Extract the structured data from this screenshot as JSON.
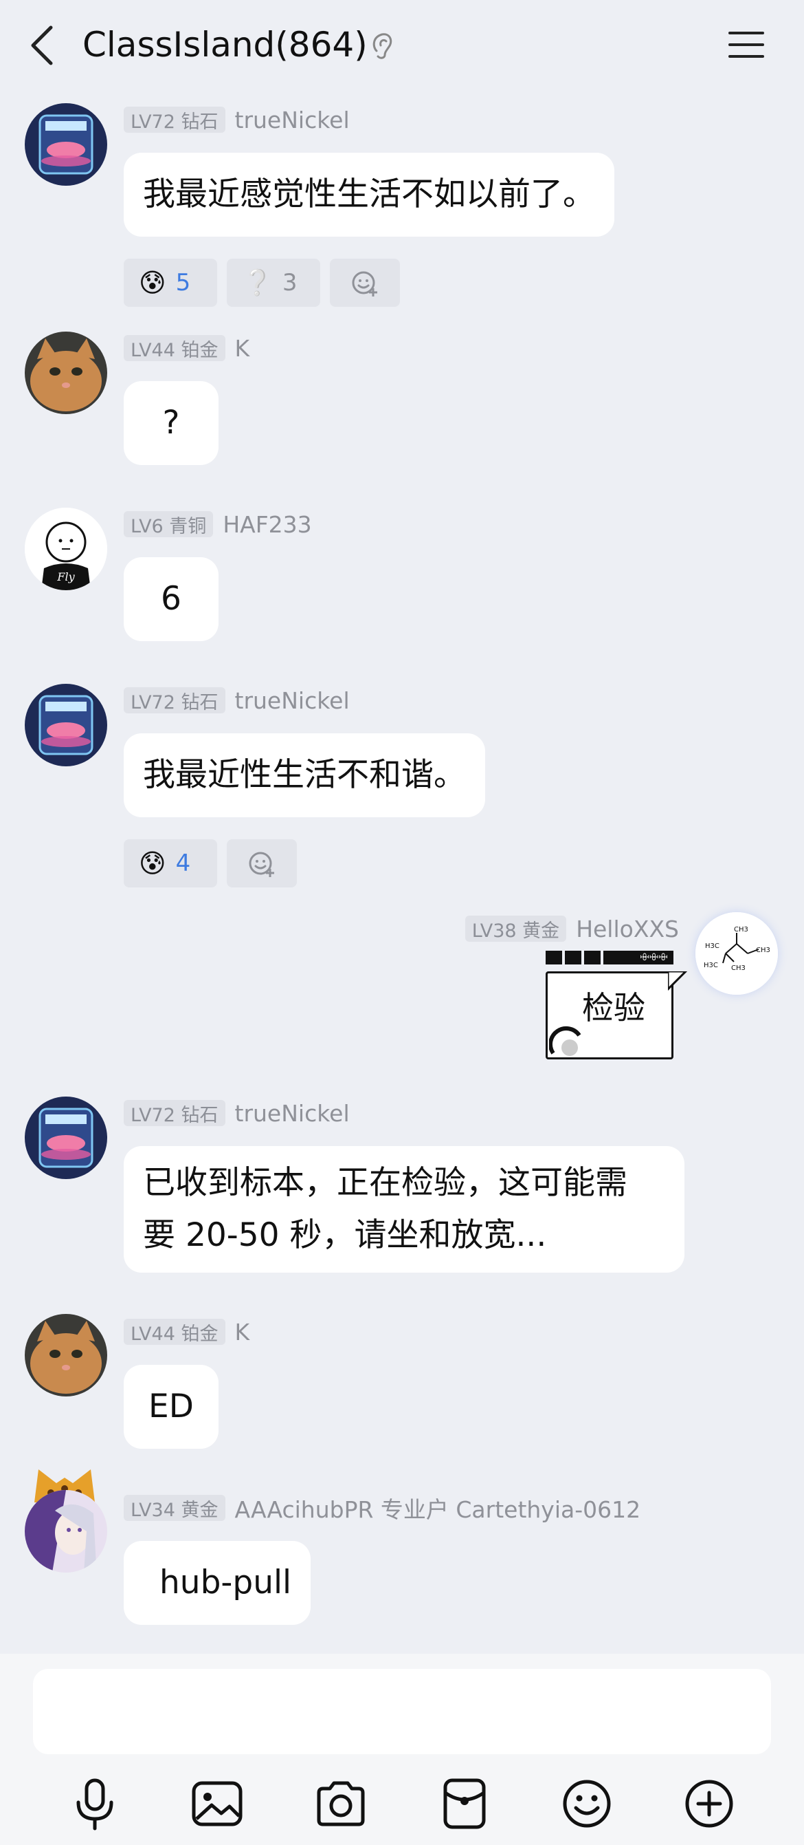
{
  "header": {
    "title": "ClassIsland(864)"
  },
  "messages": [
    {
      "level": "LV72 钻石",
      "name": "trueNickel",
      "text": "我最近感觉性生活不如以前了。",
      "reactions": [
        {
          "emoji": "😰",
          "count": "5"
        },
        {
          "emoji": "❔",
          "count": "3"
        }
      ]
    },
    {
      "level": "LV44 铂金",
      "name": "K",
      "text": "?"
    },
    {
      "level": "LV6 青铜",
      "name": "HAF233",
      "text": "6"
    },
    {
      "level": "LV72 钻石",
      "name": "trueNickel",
      "text": "我最近性生活不和谐。",
      "reactions": [
        {
          "emoji": "😰",
          "count": "4"
        }
      ]
    },
    {
      "level": "LV38 黄金",
      "name": "HelloXXS",
      "text": "检验",
      "sticker_bar": "ꗳꗳꗳ"
    },
    {
      "level": "LV72 钻石",
      "name": "trueNickel",
      "text_line1": "已收到标本，正在检验，这可能需",
      "text_line2": "要 20-50 秒，请坐和放宽..."
    },
    {
      "level": "LV44 铂金",
      "name": "K",
      "text": "ED"
    },
    {
      "level": "LV34 黄金",
      "name": "AAAcihubPR 专业户 Cartethyia-0612",
      "text": "hub-pull"
    }
  ],
  "colors": {
    "background": "#EDEFF4",
    "bubble": "#FFFFFF",
    "accent_count": "#3E7BE0",
    "level_badge": "#E0E2E8"
  },
  "icons": [
    "back-arrow-icon",
    "ear-icon",
    "menu-icon",
    "add-reaction-icon",
    "microphone-icon",
    "image-icon",
    "camera-icon",
    "red-packet-icon",
    "emoji-icon",
    "plus-icon"
  ]
}
